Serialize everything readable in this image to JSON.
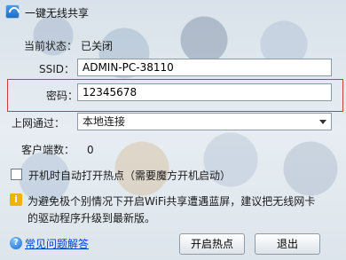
{
  "window": {
    "title": "一键无线共享"
  },
  "status": {
    "label": "当前状态：",
    "value": "已关闭"
  },
  "ssid": {
    "label": "SSID：",
    "value": "ADMIN-PC-38110"
  },
  "password": {
    "label": "密码：",
    "value": "12345678"
  },
  "network": {
    "label": "上网通过：",
    "selected": "本地连接"
  },
  "clients": {
    "label": "客户端数：",
    "value": "0"
  },
  "autostart": {
    "label": "开机时自动打开热点（需要魔方开机启动）",
    "checked": false
  },
  "notice": {
    "line1": "为避免极个别情况下开启WiFi共享遭遇蓝屏，建议把无线网卡",
    "line2": "的驱动程序升级到最新版。"
  },
  "help": {
    "link": "常见问题解答"
  },
  "buttons": {
    "start": "开启热点",
    "exit": "退出"
  }
}
